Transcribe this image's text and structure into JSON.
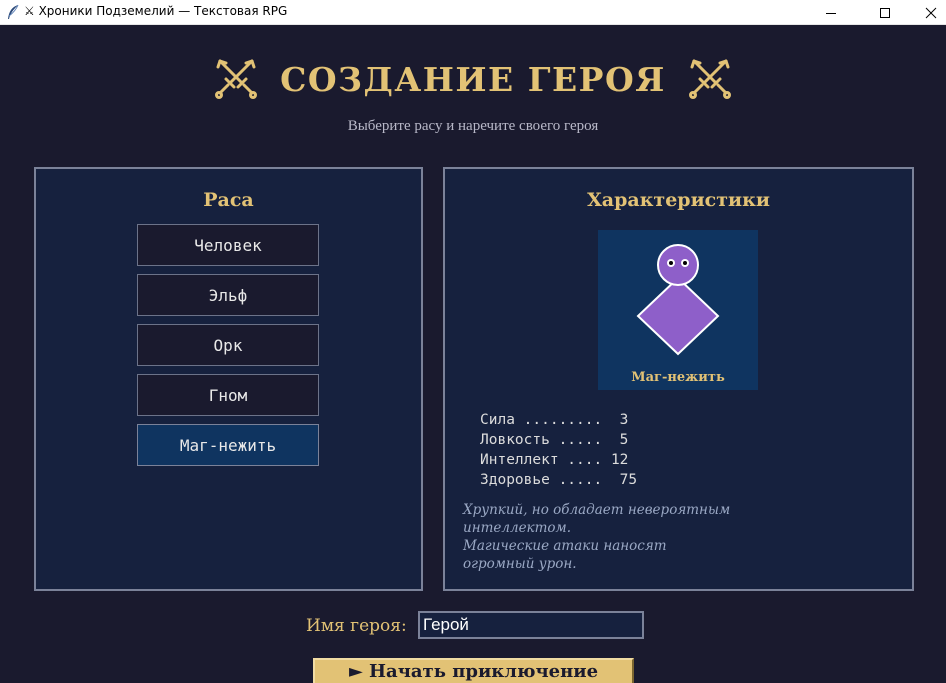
{
  "window": {
    "title": "⚔ Хроники Подземелий — Текстовая RPG",
    "minimize_glyph": "—",
    "maximize_glyph": "☐",
    "close_glyph": "✕"
  },
  "header": {
    "title": "СОЗДАНИЕ ГЕРОЯ",
    "subtitle": "Выберите расу и наречите своего героя",
    "icon": "crossed-swords-icon"
  },
  "race_panel": {
    "title": "Раса",
    "races": [
      {
        "label": "Человек",
        "selected": false
      },
      {
        "label": "Эльф",
        "selected": false
      },
      {
        "label": "Орк",
        "selected": false
      },
      {
        "label": "Гном",
        "selected": false
      },
      {
        "label": "Маг-нежить",
        "selected": true
      }
    ]
  },
  "stats_panel": {
    "title": "Характеристики",
    "avatar_label": "Маг-нежить",
    "avatar_color": "#8e5fc9",
    "stats": [
      "Сила .........  3",
      "Ловкость .....  5",
      "Интеллект .... 12",
      "Здоровье .....  75"
    ],
    "description": [
      "Хрупкий, но обладает невероятным",
      "интеллектом.",
      "Магические атаки наносят",
      "огромный урон."
    ]
  },
  "name_field": {
    "label": "Имя героя:",
    "value": "Герой"
  },
  "start_button": {
    "label": "► Начать приключение"
  },
  "colors": {
    "background": "#1a1a2e",
    "panel": "#16213e",
    "accent_gold": "#e2c275",
    "selected": "#0f3460"
  }
}
